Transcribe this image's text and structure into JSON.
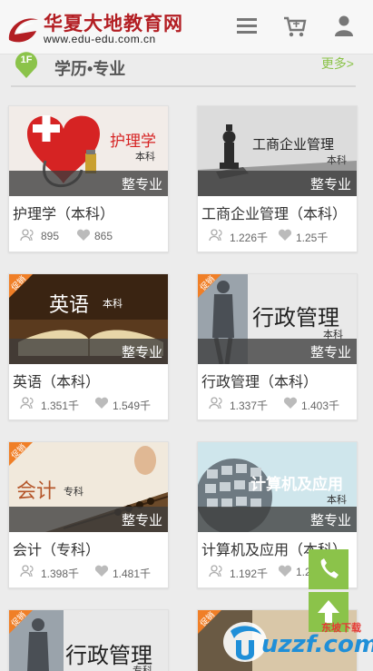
{
  "header": {
    "site_name": "华夏大地教育网",
    "site_url": "www.edu-edu.com.cn",
    "logo_letter": "e"
  },
  "section": {
    "floor": "1F",
    "title": "学历•专业",
    "more": "更多>"
  },
  "cards": [
    {
      "image_title": "护理学",
      "image_sub": "本科",
      "band": "整专业",
      "title": "护理学（本科）",
      "views": "895",
      "likes": "865",
      "promo": false
    },
    {
      "image_title": "工商企业管理",
      "image_sub": "本科",
      "band": "整专业",
      "title": "工商企业管理（本科）",
      "views": "1.226千",
      "likes": "1.25千",
      "promo": false
    },
    {
      "image_title": "英语",
      "image_sub": "本科",
      "band": "整专业",
      "title": "英语（本科）",
      "views": "1.351千",
      "likes": "1.549千",
      "promo": true
    },
    {
      "image_title": "行政管理",
      "image_sub": "本科",
      "band": "整专业",
      "title": "行政管理（本科）",
      "views": "1.337千",
      "likes": "1.403千",
      "promo": true
    },
    {
      "image_title": "会计",
      "image_sub": "专科",
      "band": "整专业",
      "title": "会计（专科）",
      "views": "1.398千",
      "likes": "1.481千",
      "promo": true
    },
    {
      "image_title": "计算机及应用",
      "image_sub": "本科",
      "band": "整专业",
      "title": "计算机及应用（本科）",
      "views": "1.192千",
      "likes": "1.2",
      "promo": false
    },
    {
      "image_title": "行政管理",
      "image_sub": "专科",
      "promo": true
    },
    {
      "image_title": "",
      "image_sub": "",
      "promo": true
    }
  ],
  "promo_label": "促销",
  "watermark": {
    "brand": "uzzf.com",
    "tag": "东坡下载"
  },
  "colors": {
    "brand_red": "#b31e23",
    "accent_green": "#8bc34a",
    "band": "#3c3c3c"
  },
  "icons": [
    "menu-icon",
    "cart-icon",
    "user-icon",
    "phone-icon",
    "arrow-up-icon",
    "views-icon",
    "likes-icon"
  ]
}
